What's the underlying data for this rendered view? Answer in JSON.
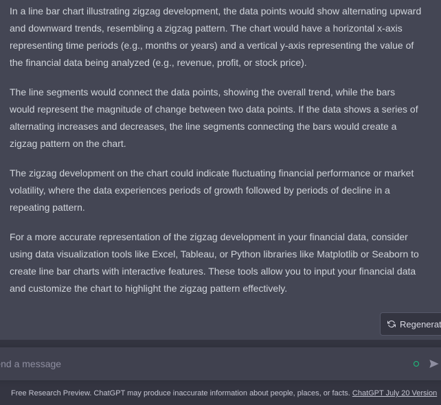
{
  "conversation": {
    "assistant_message": {
      "paragraphs": [
        "In a line bar chart illustrating zigzag development, the data points would show alternating upward and downward trends, resembling a zigzag pattern. The chart would have a horizontal x-axis representing time periods (e.g., months or years) and a vertical y-axis representing the value of the financial data being analyzed (e.g., revenue, profit, or stock price).",
        "The line segments would connect the data points, showing the overall trend, while the bars would represent the magnitude of change between two data points. If the data shows a series of alternating increases and decreases, the line segments connecting the bars would create a zigzag pattern on the chart.",
        "The zigzag development on the chart could indicate fluctuating financial performance or market volatility, where the data experiences periods of growth followed by periods of decline in a repeating pattern.",
        "For a more accurate representation of the zigzag development in your financial data, consider using data visualization tools like Excel, Tableau, or Python libraries like Matplotlib or Seaborn to create line bar charts with interactive features. These tools allow you to input your financial data and customize the chart to highlight the zigzag pattern effectively."
      ]
    }
  },
  "regenerate_button": {
    "label": "Regenerate",
    "icon": "refresh-icon"
  },
  "composer": {
    "placeholder": "Send a message",
    "send_icon": "send-icon"
  },
  "footer": {
    "note": "Free Research Preview. ChatGPT may produce inaccurate information about people, places, or facts. ",
    "version_link": "ChatGPT July 20 Version"
  },
  "colors": {
    "background": "#343541",
    "assistant_bg": "#444654",
    "text": "#d1d5db",
    "status_green": "#19c37d"
  }
}
